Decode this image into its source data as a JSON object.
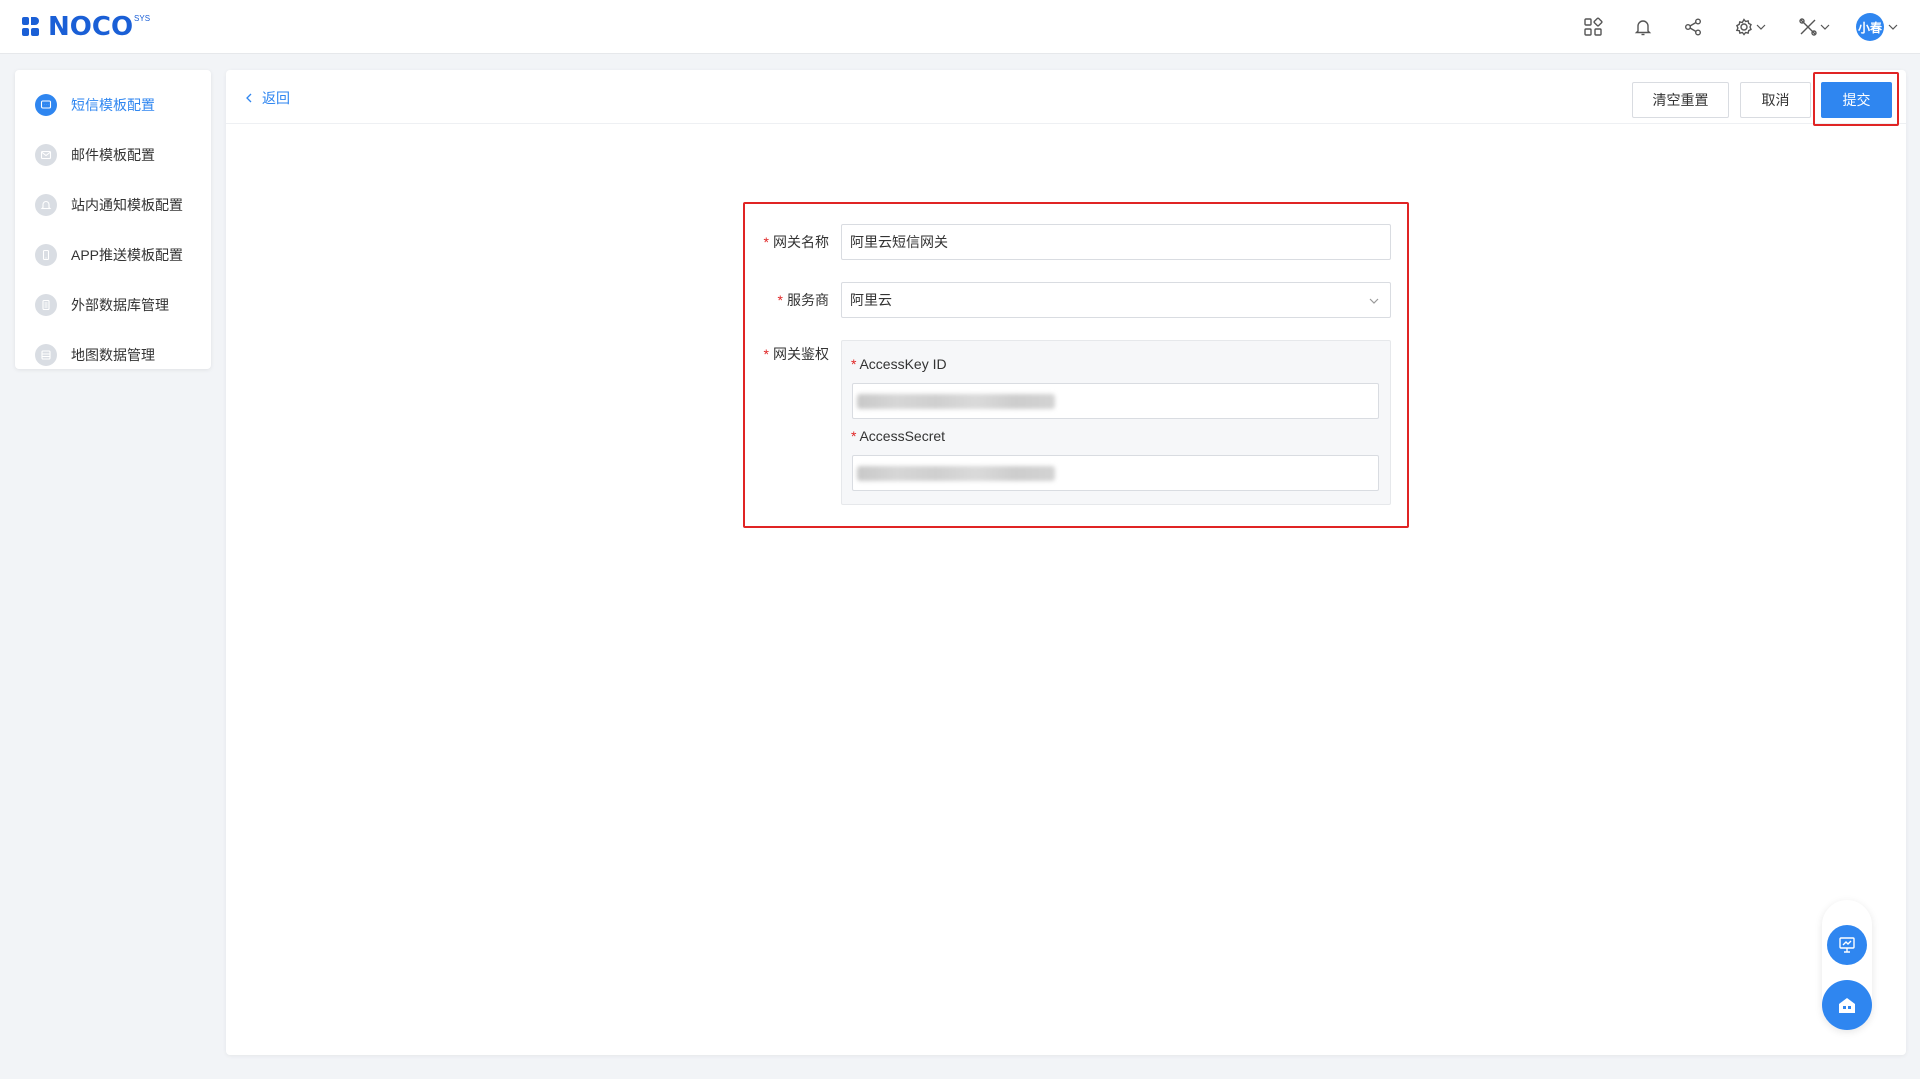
{
  "brand": {
    "name": "NOCO",
    "sup": "SYS",
    "color": "#1a5fd6"
  },
  "topbar": {
    "icons": [
      "apps-icon",
      "bell-icon",
      "share-icon",
      "settings-icon",
      "tools-icon"
    ],
    "user": {
      "avatar_text": "小春"
    }
  },
  "sidebar": {
    "items": [
      {
        "label": "短信模板配置",
        "icon": "sms-icon",
        "active": true
      },
      {
        "label": "邮件模板配置",
        "icon": "mail-icon",
        "active": false
      },
      {
        "label": "站内通知模板配置",
        "icon": "bell-icon",
        "active": false
      },
      {
        "label": "APP推送模板配置",
        "icon": "phone-icon",
        "active": false
      },
      {
        "label": "外部数据库管理",
        "icon": "database-icon",
        "active": false
      },
      {
        "label": "地图数据管理",
        "icon": "map-icon",
        "active": false
      }
    ]
  },
  "header": {
    "back_label": "返回",
    "reset_label": "清空重置",
    "cancel_label": "取消",
    "submit_label": "提交"
  },
  "form": {
    "gateway_name": {
      "label": "网关名称",
      "value": "阿里云短信网关"
    },
    "provider": {
      "label": "服务商",
      "value": "阿里云"
    },
    "auth": {
      "label": "网关鉴权",
      "access_key_id": {
        "label": "AccessKey ID"
      },
      "access_secret": {
        "label": "AccessSecret"
      }
    }
  },
  "colors": {
    "accent": "#2f86f0",
    "highlight": "#e02424"
  }
}
